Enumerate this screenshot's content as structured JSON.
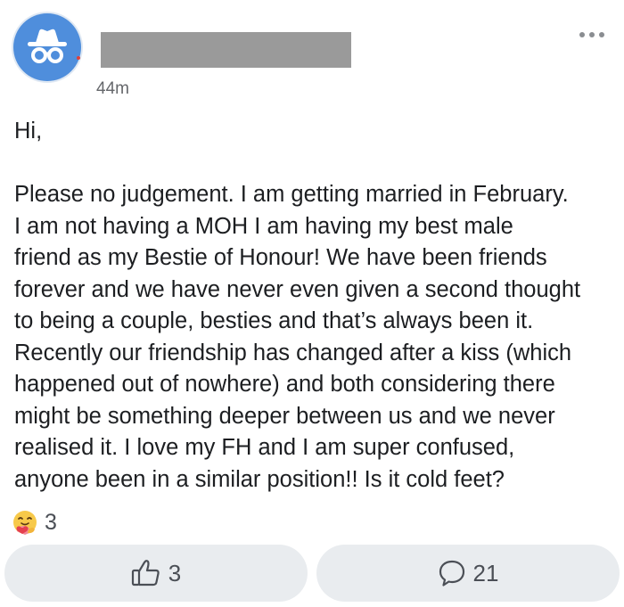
{
  "post": {
    "timestamp": "44m",
    "greeting": "Hi,",
    "body_lines": [
      "Please no judgement.  I am getting married in February.",
      "I am not having a MOH I am having my best male",
      "friend as my Bestie of Honour! We have been friends",
      "forever and we have never even given a second thought",
      "to being a couple, besties and that’s always been it.",
      "Recently our friendship has changed after a kiss (which",
      "happened out of nowhere) and both considering there",
      "might be something deeper between us and we never",
      "realised it.  I love my FH and I am super confused,",
      "anyone been in a similar position!! Is it cold feet?"
    ]
  },
  "reactions": {
    "icon": "care-emoji-icon",
    "count": "3"
  },
  "actions": {
    "like_count": "3",
    "comment_count": "21"
  },
  "icons": {
    "avatar": "incognito-icon",
    "more": "more-dots-icon",
    "like": "thumbs-up-icon",
    "comment": "comment-bubble-icon"
  },
  "colors": {
    "avatar_bg": "#4f8edc",
    "redaction": "#9a9a9a",
    "button_bg": "#e9ecef",
    "text": "#1c1e21",
    "muted": "#65676b"
  }
}
